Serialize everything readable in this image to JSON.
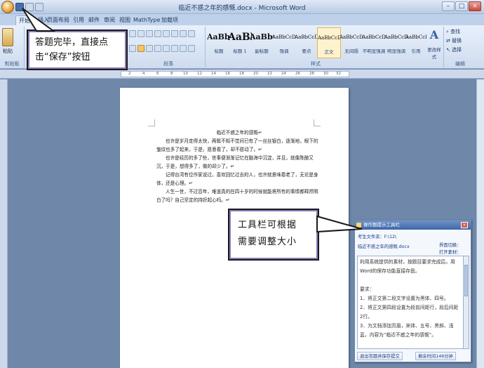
{
  "titlebar": {
    "window_title": "临近不惑之年的感慨.docx - Microsoft Word",
    "min_label": "–",
    "max_label": "□",
    "close_label": "×"
  },
  "ribbon_tabs": [
    "开始",
    "插入",
    "页面布局",
    "引用",
    "邮件",
    "审阅",
    "视图",
    "MathType",
    "加载项"
  ],
  "ribbon": {
    "paste_label": "粘贴",
    "clipboard_label": "剪贴板",
    "paragraph_label": "段落",
    "styles_label": "样式",
    "editing_label": "编辑",
    "styles": [
      {
        "sample": "AaBbC",
        "name": "标题",
        "size": "mid"
      },
      {
        "sample": "AaBb",
        "name": "标题 1",
        "size": "big"
      },
      {
        "sample": "AaBbC",
        "name": "副标题",
        "size": "mid"
      },
      {
        "sample": "AaBbCcDd",
        "name": "强调",
        "size": "small"
      },
      {
        "sample": "AaBbCcD",
        "name": "要点",
        "size": "small"
      },
      {
        "sample": "AaBbCcDd",
        "name": "正文",
        "size": "small"
      },
      {
        "sample": "AaBbCcDd",
        "name": "无间隔",
        "size": "small"
      },
      {
        "sample": "AaBbCcD",
        "name": "不明显强调",
        "size": "small"
      },
      {
        "sample": "AaBbCcDd",
        "name": "明显强调",
        "size": "small"
      },
      {
        "sample": "AaBbCcDd",
        "name": "引用",
        "size": "small"
      }
    ],
    "change_styles_label": "更改样式",
    "editing": [
      "查找",
      "替换",
      "选择"
    ]
  },
  "callouts": {
    "save_hint_line1": "答题完毕，直接点",
    "save_hint_line2": "击“保存”按钮",
    "toolbar_hint_line1": "工具栏可根据",
    "toolbar_hint_line2": "需要调整大小"
  },
  "document": {
    "title": "临近不惑之年的感慨↵",
    "paragraphs": [
      "也许是岁月走得太快，两鬓不知不觉间已有了一丝丝银白，逐渐地，眼下的皱纹也多了起来，于是，愿意看了，却不愿动了。↵",
      "也许是经历的多了些，世事便渐渐记忆在脑海中沉淀，并且，就像陈酿又沉，于是，想得多了，做的却少了。↵",
      "记得台湾有位作家说过，喜欢回忆过去的人，也许就意味着老了，无论是身体，还是心理。↵",
      "人生一世，不过百年，难道真的在四十岁的时候就能将所有的事情都释然明白了吗？自己坚定的持好起心吗。↵"
    ]
  },
  "tool_panel": {
    "title": "操作题提示工具栏",
    "close_label": "×",
    "student_file_label": "考生文件夹：",
    "student_file_value": "F:\\12\\",
    "doc_name": "临近不惑之年的感慨.docx",
    "right_link_1": "界面切换：",
    "right_link_2": "打开素材：",
    "content_lines": [
      "利用系统提供的素材，按题目要求完成后，用Word的保存功能直接存盘。",
      "",
      "要求：",
      "1．将正文第二段文字设置为黑体、四号。",
      "2．将正文第四段设置为段前间距行，段后间距2行。",
      "3．为文档添加页眉，宋体、五号、黑斜、浅蓝，内容为“临近不惑之年的感慨”。"
    ],
    "submit_label": "退出答题并保存提交",
    "timer_label": "剩余时间146分钟"
  }
}
